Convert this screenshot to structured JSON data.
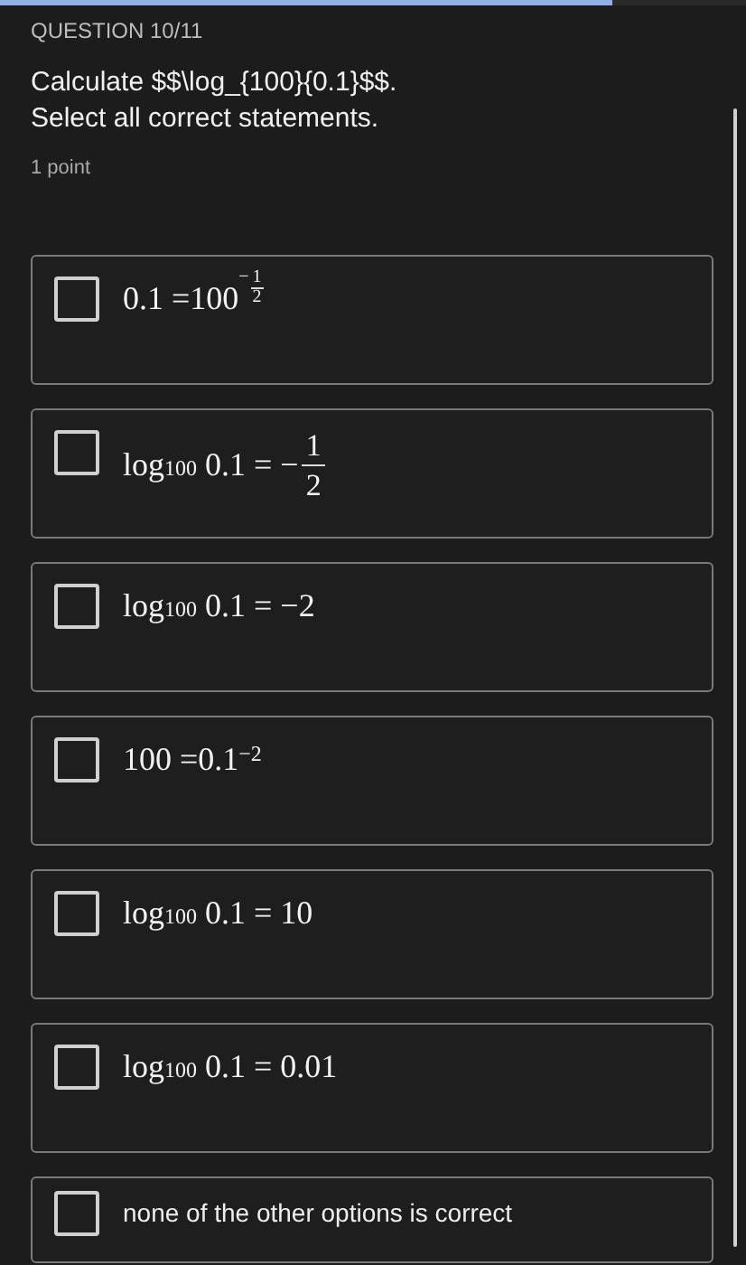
{
  "progress": {
    "level": 0.82
  },
  "question": {
    "number": "QUESTION 10/11",
    "prompt": [
      "Calculate $$\\log_{100}{0.1}$$.",
      "Select all correct statements."
    ],
    "points": "1 point"
  },
  "options": [
    {
      "kind": "math",
      "checked": false,
      "segments": [
        {
          "kind": "text",
          "text": "0.1 =100"
        },
        {
          "kind": "sup_frac",
          "sign": "−",
          "num": "1",
          "den": "2"
        }
      ]
    },
    {
      "kind": "math",
      "checked": false,
      "segments": [
        {
          "kind": "text",
          "text": "log"
        },
        {
          "kind": "sub",
          "text": "100"
        },
        {
          "kind": "text",
          "text": " 0.1 = −"
        },
        {
          "kind": "frac",
          "num": "1",
          "den": "2"
        }
      ]
    },
    {
      "kind": "math",
      "checked": false,
      "segments": [
        {
          "kind": "text",
          "text": "log"
        },
        {
          "kind": "sub",
          "text": "100"
        },
        {
          "kind": "text",
          "text": " 0.1 = −2"
        }
      ]
    },
    {
      "kind": "math",
      "checked": false,
      "segments": [
        {
          "kind": "text",
          "text": "100 =0.1"
        },
        {
          "kind": "sup",
          "text": "−2"
        }
      ]
    },
    {
      "kind": "math",
      "checked": false,
      "segments": [
        {
          "kind": "text",
          "text": "log"
        },
        {
          "kind": "sub",
          "text": "100"
        },
        {
          "kind": "text",
          "text": " 0.1 = 10"
        }
      ]
    },
    {
      "kind": "math",
      "checked": false,
      "segments": [
        {
          "kind": "text",
          "text": "log"
        },
        {
          "kind": "sub",
          "text": "100"
        },
        {
          "kind": "text",
          "text": " 0.1 = 0.01"
        }
      ]
    },
    {
      "kind": "text",
      "checked": false,
      "text": "none of the other options is correct"
    }
  ]
}
